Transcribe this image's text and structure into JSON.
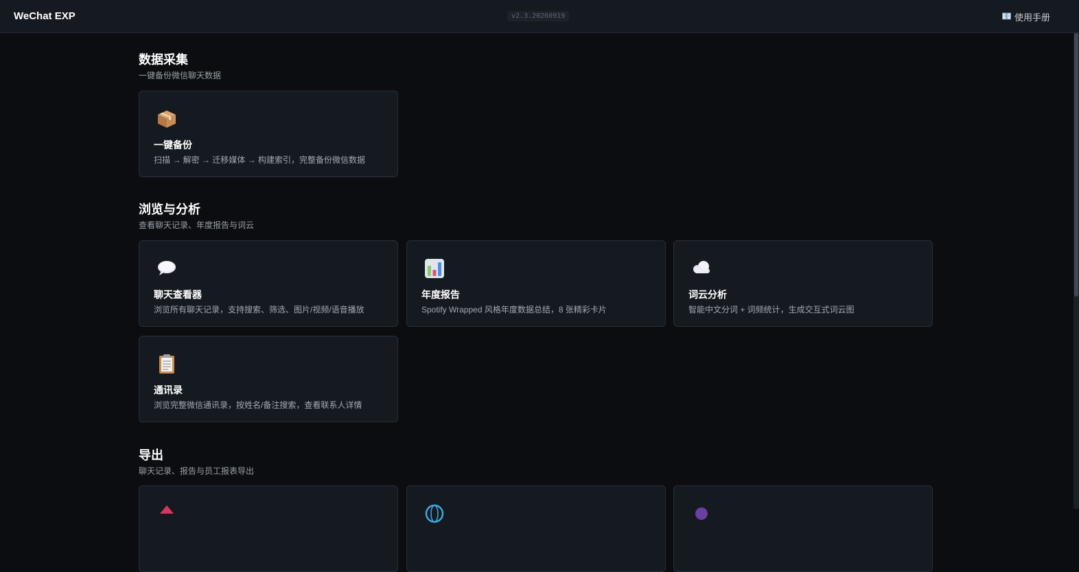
{
  "header": {
    "brand": "WeChat EXP",
    "version": "v2.3.20260919",
    "manual_label": "使用手册"
  },
  "sections": [
    {
      "title": "数据采集",
      "subtitle": "一键备份微信聊天数据",
      "cards": [
        {
          "icon": "package-icon",
          "title": "一键备份",
          "desc": "扫描 → 解密 → 迁移媒体 → 构建索引，完整备份微信数据"
        }
      ]
    },
    {
      "title": "浏览与分析",
      "subtitle": "查看聊天记录、年度报告与词云",
      "cards": [
        {
          "icon": "speech-bubble-icon",
          "title": "聊天查看器",
          "desc": "浏览所有聊天记录，支持搜索、筛选、图片/视频/语音播放"
        },
        {
          "icon": "bar-chart-icon",
          "title": "年度报告",
          "desc": "Spotify Wrapped 风格年度数据总结，8 张精彩卡片"
        },
        {
          "icon": "cloud-icon",
          "title": "词云分析",
          "desc": "智能中文分词 + 词频统计，生成交互式词云图"
        },
        {
          "icon": "clipboard-icon",
          "title": "通讯录",
          "desc": "浏览完整微信通讯录，按姓名/备注搜索，查看联系人详情"
        }
      ]
    },
    {
      "title": "导出",
      "subtitle": "聊天记录、报告与员工报表导出",
      "cards": [
        {
          "icon": "export-red-icon"
        },
        {
          "icon": "globe-icon"
        },
        {
          "icon": "purple-orb-icon"
        }
      ]
    }
  ]
}
